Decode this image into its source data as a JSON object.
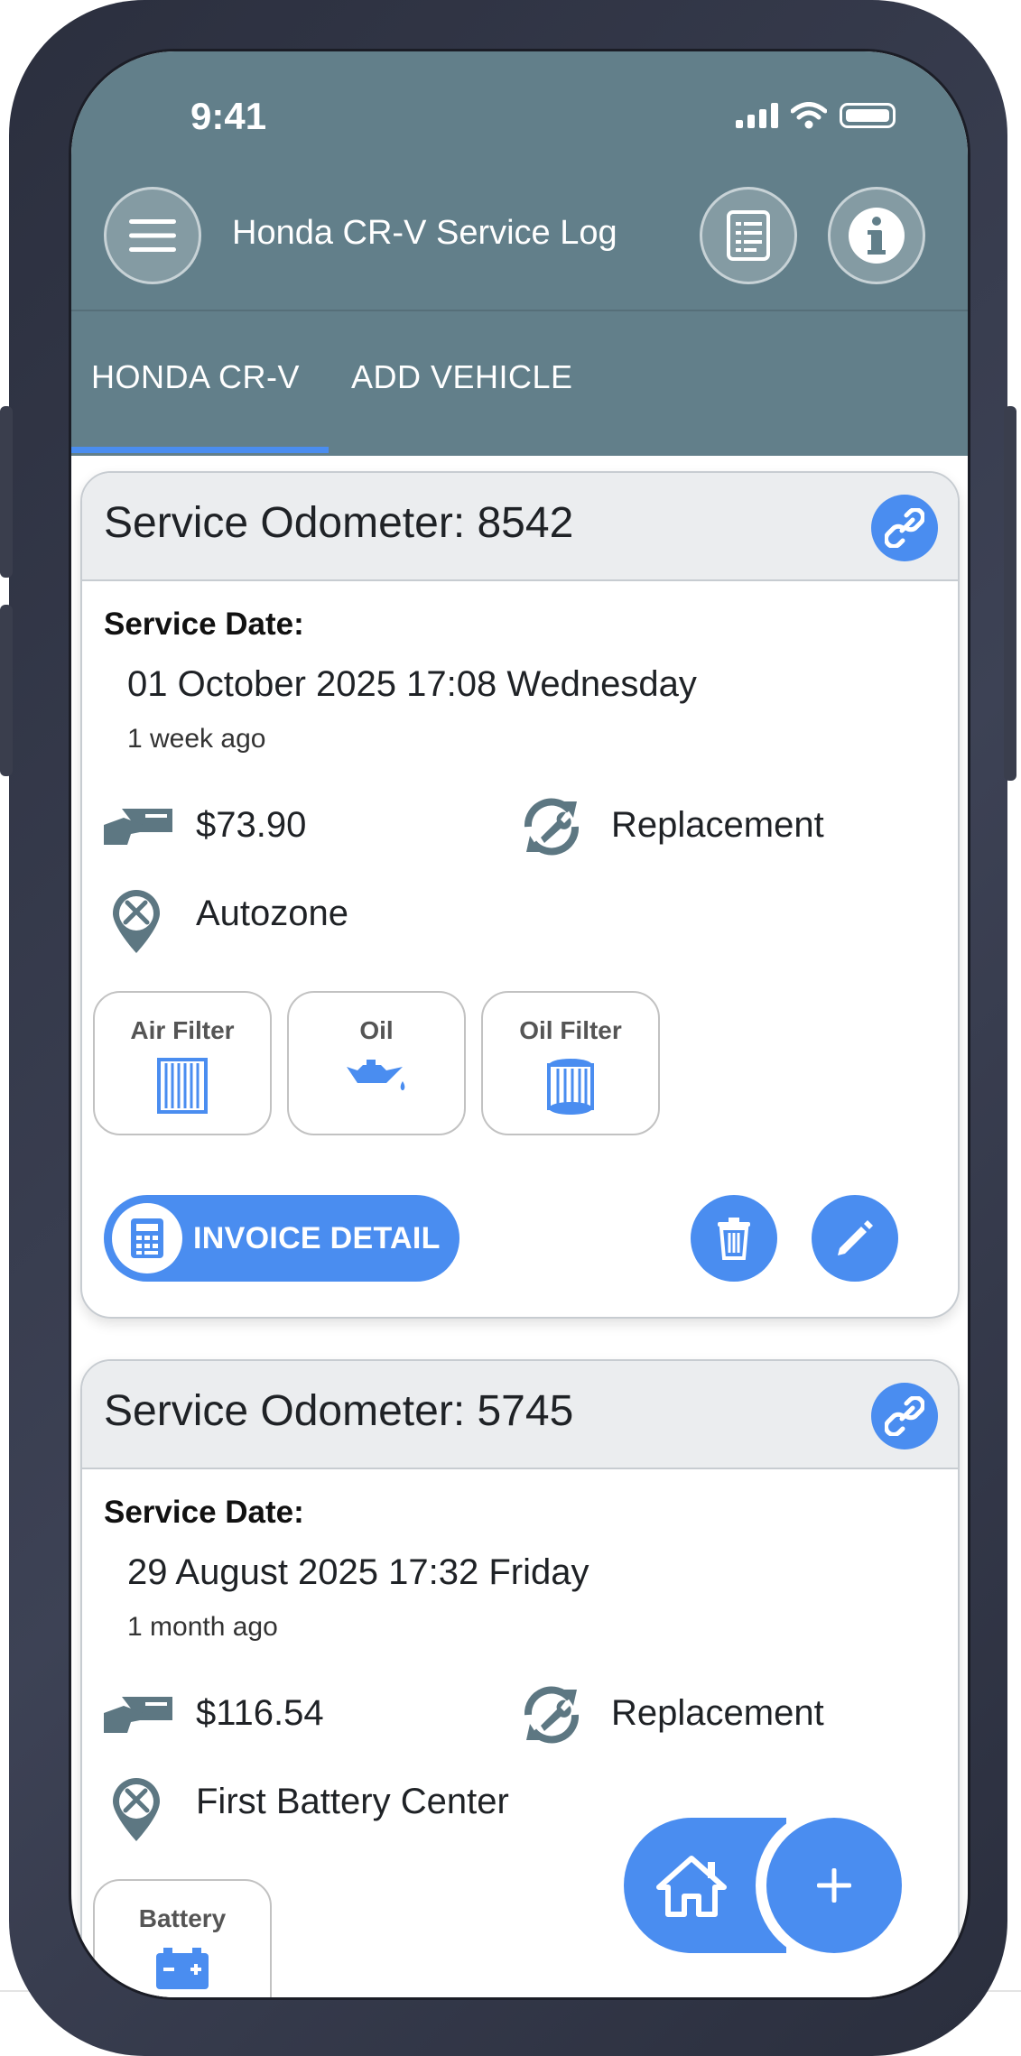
{
  "status_bar": {
    "time": "9:41"
  },
  "header": {
    "title": "Honda CR-V Service Log",
    "tabs": [
      {
        "label": "HONDA CR-V",
        "active": true
      },
      {
        "label": "ADD VEHICLE",
        "active": false
      }
    ]
  },
  "icons": {
    "menu": "hamburger-menu-icon",
    "report": "document-list-icon",
    "info": "info-icon",
    "link": "link-icon",
    "cost": "hand-cash-icon",
    "service_type": "wrench-refresh-icon",
    "location": "location-tools-icon",
    "invoice": "calculator-icon",
    "delete": "trash-icon",
    "edit": "pencil-icon",
    "home": "home-icon",
    "add": "plus-icon"
  },
  "colors": {
    "accent": "#4a8df0",
    "header": "#627f8a",
    "card_head": "#ebedef"
  },
  "services": [
    {
      "odometer": "Service Odometer: 8542",
      "date_label": "Service Date:",
      "date": "01 October 2025 17:08 Wednesday",
      "relative": "1 week ago",
      "cost": "$73.90",
      "type": "Replacement",
      "location": "Autozone",
      "parts": [
        "Air Filter",
        "Oil",
        "Oil Filter"
      ],
      "invoice_label": "INVOICE DETAIL"
    },
    {
      "odometer": "Service Odometer: 5745",
      "date_label": "Service Date:",
      "date": "29 August 2025 17:32 Friday",
      "relative": "1 month ago",
      "cost": "$116.54",
      "type": "Replacement",
      "location": "First Battery Center",
      "parts": [
        "Battery"
      ]
    }
  ]
}
